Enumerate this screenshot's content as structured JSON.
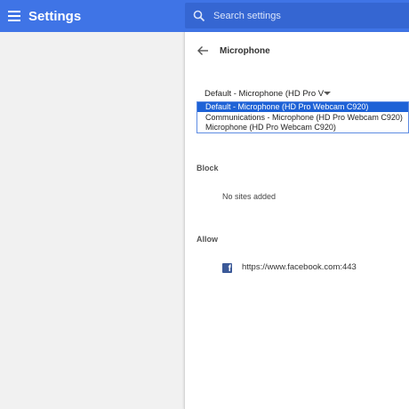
{
  "header": {
    "title": "Settings",
    "search_placeholder": "Search settings"
  },
  "page": {
    "title": "Microphone"
  },
  "mic_select": {
    "selected_label": "Default - Microphone (HD Pro V",
    "options": [
      "Default - Microphone (HD Pro Webcam C920)",
      "Communications - Microphone (HD Pro Webcam C920)",
      "Microphone (HD Pro Webcam C920)"
    ],
    "highlighted_index": 0
  },
  "block": {
    "label": "Block",
    "empty_text": "No sites added"
  },
  "allow": {
    "label": "Allow",
    "sites": [
      {
        "icon": "facebook-icon",
        "url": "https://www.facebook.com:443"
      }
    ]
  },
  "colors": {
    "header_bg": "#3f74e6",
    "search_bg": "#3566d2",
    "highlight": "#1e62d6",
    "facebook": "#3b5998"
  }
}
